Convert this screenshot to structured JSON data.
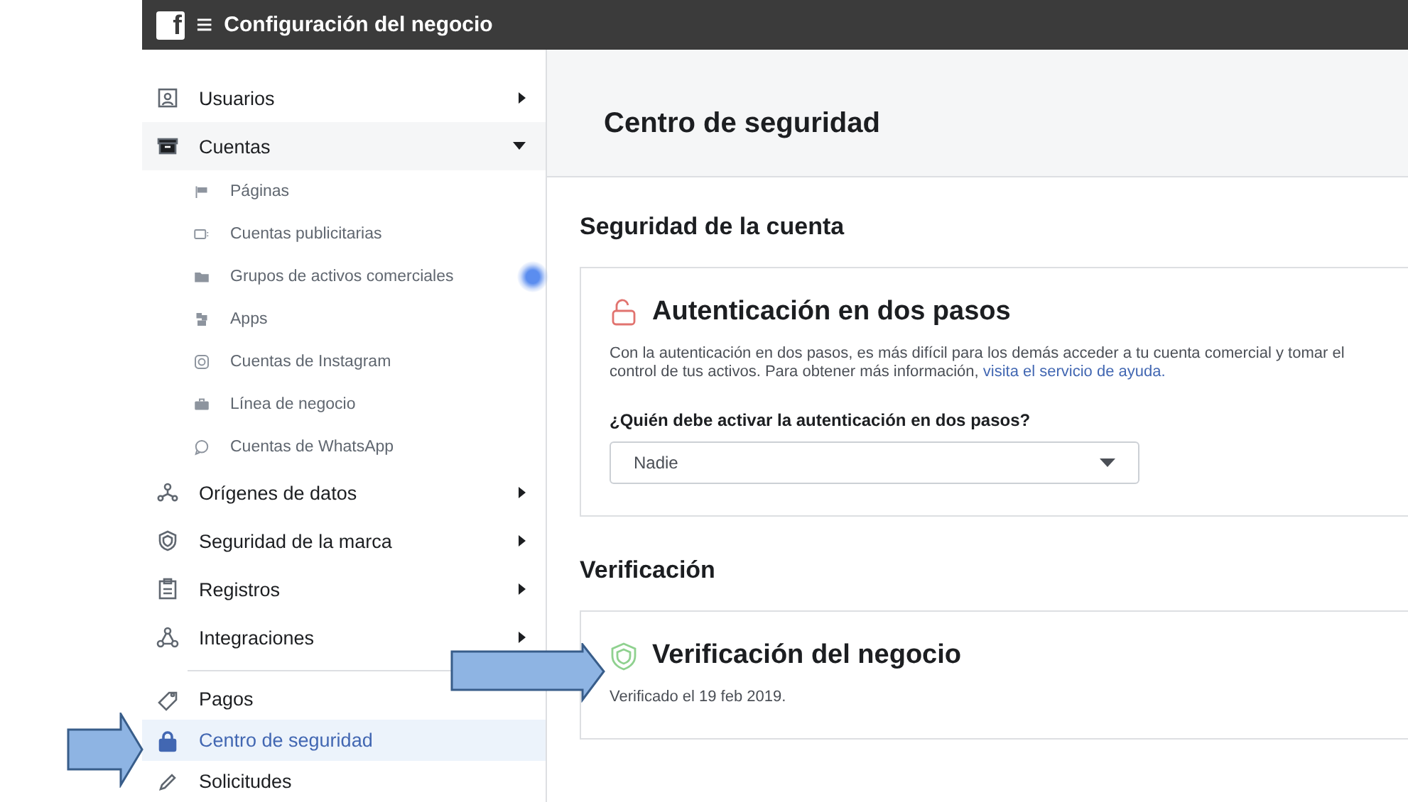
{
  "app_bar": {
    "logo": "f",
    "menu_glyph": "≡",
    "title": "Configuración del negocio"
  },
  "sidebar": {
    "sections": [
      {
        "items": [
          {
            "label": "Usuarios",
            "kind": "group",
            "expanded": false,
            "selected": false
          },
          {
            "label": "Cuentas",
            "kind": "group",
            "expanded": true,
            "selected": false,
            "children": [
              {
                "label": "Páginas",
                "selected": false
              },
              {
                "label": "Cuentas publicitarias",
                "selected": false
              },
              {
                "label": "Grupos de activos comerciales",
                "selected": false
              },
              {
                "label": "Apps",
                "selected": false
              },
              {
                "label": "Cuentas de Instagram",
                "selected": false
              },
              {
                "label": "Línea de negocio",
                "selected": false
              },
              {
                "label": "Cuentas de WhatsApp",
                "selected": false
              }
            ]
          },
          {
            "label": "Orígenes de datos",
            "kind": "group",
            "expanded": false,
            "selected": false
          },
          {
            "label": "Seguridad de la marca",
            "kind": "group",
            "expanded": false,
            "selected": false
          },
          {
            "label": "Registros",
            "kind": "group",
            "expanded": false,
            "selected": false
          },
          {
            "label": "Integraciones",
            "kind": "group",
            "expanded": false,
            "selected": false
          }
        ]
      },
      {
        "items": [
          {
            "label": "Pagos",
            "kind": "link",
            "selected": false
          },
          {
            "label": "Centro de seguridad",
            "kind": "link",
            "selected": true
          },
          {
            "label": "Solicitudes",
            "kind": "link",
            "selected": false
          }
        ]
      }
    ]
  },
  "main": {
    "page_title": "Centro de seguridad",
    "sections": [
      {
        "heading": "Seguridad de la cuenta",
        "cards": [
          {
            "kind": "two_factor",
            "title": "Autenticación en dos pasos",
            "description": "Con la autenticación en dos pasos, es más difícil para los demás acceder a tu cuenta comercial y tomar el control de tus activos. Para obtener más información, ",
            "link": "visita el servicio de ayuda.",
            "question": "¿Quién debe activar la autenticación en dos pasos?",
            "select": {
              "value": "Nadie"
            }
          }
        ]
      },
      {
        "heading": "Verificación",
        "cards": [
          {
            "kind": "verification",
            "title": "Verificación del negocio",
            "verified": true,
            "description": "Verificado el 19 feb 2019."
          }
        ]
      }
    ]
  }
}
